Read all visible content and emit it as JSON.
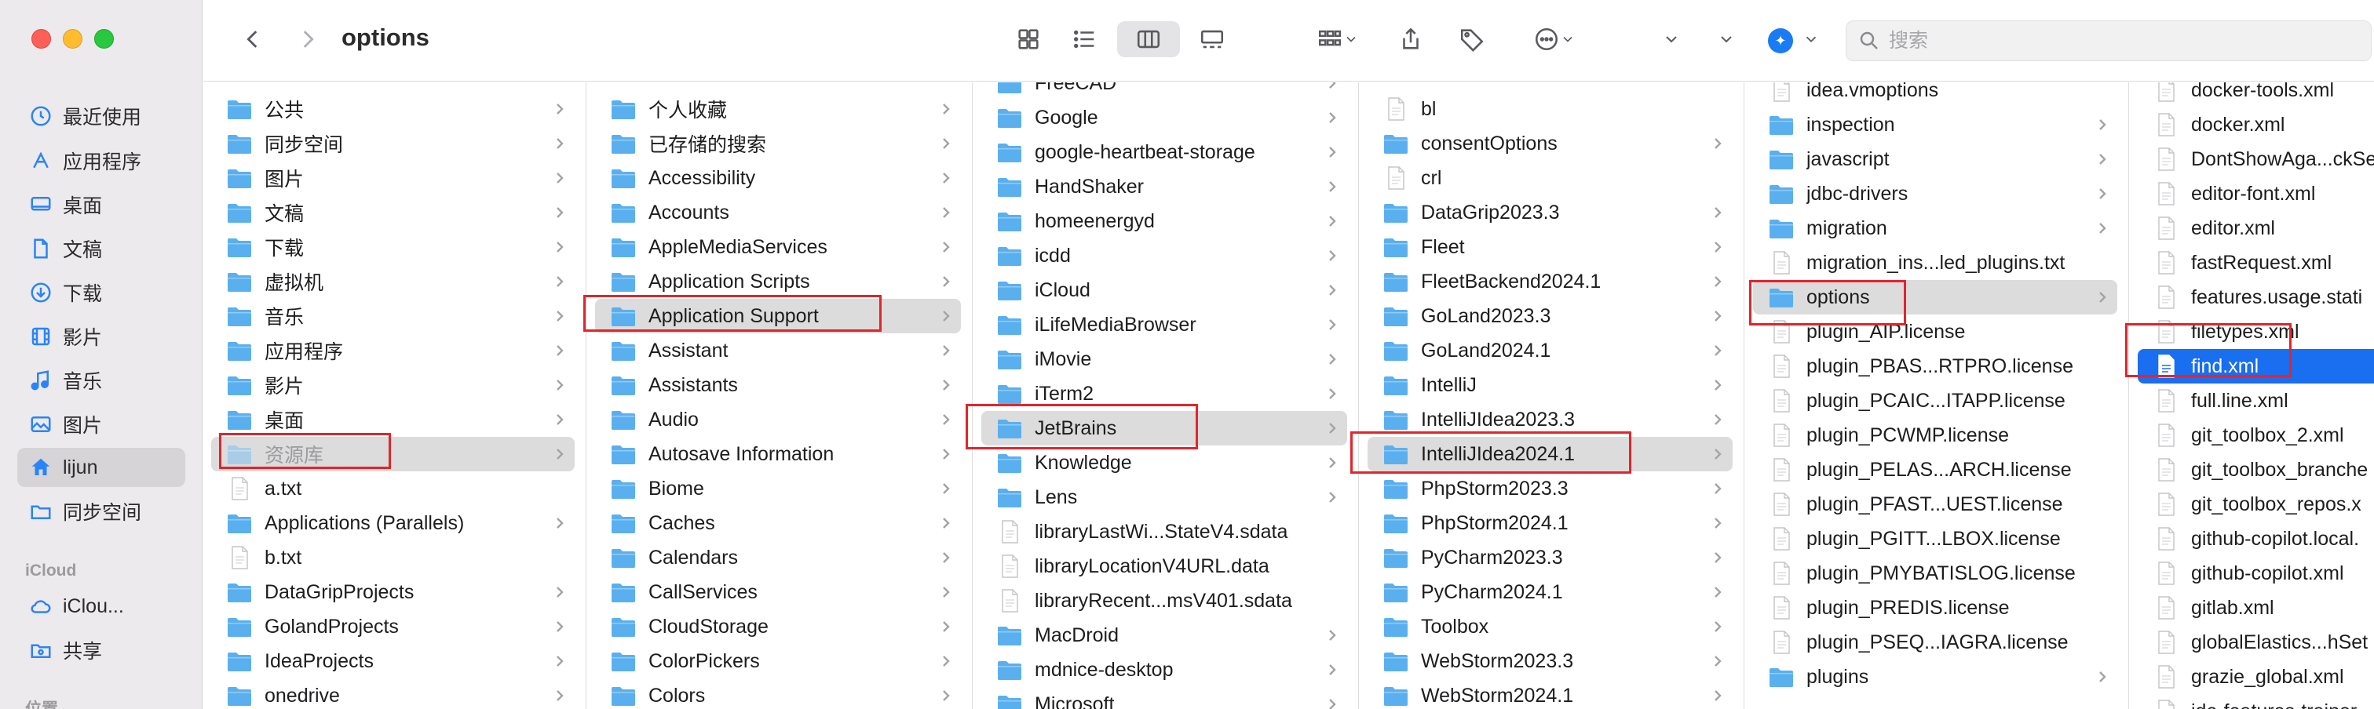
{
  "window": {
    "title": "options"
  },
  "search": {
    "placeholder": "搜索"
  },
  "colors": {
    "accent": "#1a6ef0",
    "folder": "#5ab0ef",
    "annotation": "#e4242b"
  },
  "sidebar": {
    "items": [
      {
        "label": "最近使用",
        "icon": "clock-icon"
      },
      {
        "label": "应用程序",
        "icon": "apps-icon"
      },
      {
        "label": "桌面",
        "icon": "desktop-icon"
      },
      {
        "label": "文稿",
        "icon": "doc-icon"
      },
      {
        "label": "下载",
        "icon": "download-icon"
      },
      {
        "label": "影片",
        "icon": "film-icon"
      },
      {
        "label": "音乐",
        "icon": "music-icon"
      },
      {
        "label": "图片",
        "icon": "photo-icon"
      },
      {
        "label": "lijun",
        "icon": "home-icon"
      },
      {
        "label": "同步空间",
        "icon": "folder-icon"
      }
    ],
    "section_icloud": "iCloud",
    "icloud_items": [
      {
        "label": "iClou...",
        "icon": "cloud-icon"
      },
      {
        "label": "共享",
        "icon": "shared-icon"
      }
    ],
    "section_locations": "位置"
  },
  "columns": [
    {
      "items": [
        {
          "name": "公共",
          "type": "folder",
          "chev": true
        },
        {
          "name": "同步空间",
          "type": "folder",
          "chev": true
        },
        {
          "name": "图片",
          "type": "folder",
          "chev": true
        },
        {
          "name": "文稿",
          "type": "folder",
          "chev": true
        },
        {
          "name": "下载",
          "type": "folder",
          "chev": true
        },
        {
          "name": "虚拟机",
          "type": "folder",
          "chev": true
        },
        {
          "name": "音乐",
          "type": "folder",
          "chev": true
        },
        {
          "name": "应用程序",
          "type": "folder",
          "chev": true
        },
        {
          "name": "影片",
          "type": "folder",
          "chev": true
        },
        {
          "name": "桌面",
          "type": "folder",
          "chev": true
        },
        {
          "name": "资源库",
          "type": "folder",
          "chev": true
        },
        {
          "name": "a.txt",
          "type": "file",
          "chev": false
        },
        {
          "name": "Applications (Parallels)",
          "type": "folder",
          "chev": true
        },
        {
          "name": "b.txt",
          "type": "file",
          "chev": false
        },
        {
          "name": "DataGripProjects",
          "type": "folder",
          "chev": true
        },
        {
          "name": "GolandProjects",
          "type": "folder",
          "chev": true
        },
        {
          "name": "IdeaProjects",
          "type": "folder",
          "chev": true
        },
        {
          "name": "onedrive",
          "type": "folder",
          "chev": true
        }
      ]
    },
    {
      "items": [
        {
          "name": "个人收藏",
          "type": "folder",
          "chev": true
        },
        {
          "name": "已存储的搜索",
          "type": "folder",
          "chev": true
        },
        {
          "name": "Accessibility",
          "type": "folder",
          "chev": true
        },
        {
          "name": "Accounts",
          "type": "folder",
          "chev": true
        },
        {
          "name": "AppleMediaServices",
          "type": "folder",
          "chev": true
        },
        {
          "name": "Application Scripts",
          "type": "folder",
          "chev": true
        },
        {
          "name": "Application Support",
          "type": "folder",
          "chev": true
        },
        {
          "name": "Assistant",
          "type": "folder",
          "chev": true
        },
        {
          "name": "Assistants",
          "type": "folder",
          "chev": true
        },
        {
          "name": "Audio",
          "type": "folder",
          "chev": true
        },
        {
          "name": "Autosave Information",
          "type": "folder",
          "chev": true
        },
        {
          "name": "Biome",
          "type": "folder",
          "chev": true
        },
        {
          "name": "Caches",
          "type": "folder",
          "chev": true
        },
        {
          "name": "Calendars",
          "type": "folder",
          "chev": true
        },
        {
          "name": "CallServices",
          "type": "folder",
          "chev": true
        },
        {
          "name": "CloudStorage",
          "type": "folder",
          "chev": true
        },
        {
          "name": "ColorPickers",
          "type": "folder",
          "chev": true
        },
        {
          "name": "Colors",
          "type": "folder",
          "chev": true
        }
      ]
    },
    {
      "items": [
        {
          "name": "FreeCAD",
          "type": "folder",
          "chev": true
        },
        {
          "name": "Google",
          "type": "folder",
          "chev": true
        },
        {
          "name": "google-heartbeat-storage",
          "type": "folder",
          "chev": true
        },
        {
          "name": "HandShaker",
          "type": "folder",
          "chev": true
        },
        {
          "name": "homeenergyd",
          "type": "folder",
          "chev": true
        },
        {
          "name": "icdd",
          "type": "folder",
          "chev": true
        },
        {
          "name": "iCloud",
          "type": "folder",
          "chev": true
        },
        {
          "name": "iLifeMediaBrowser",
          "type": "folder",
          "chev": true
        },
        {
          "name": "iMovie",
          "type": "folder",
          "chev": true
        },
        {
          "name": "iTerm2",
          "type": "folder",
          "chev": true
        },
        {
          "name": "JetBrains",
          "type": "folder",
          "chev": true
        },
        {
          "name": "Knowledge",
          "type": "folder",
          "chev": true
        },
        {
          "name": "Lens",
          "type": "folder",
          "chev": true
        },
        {
          "name": "libraryLastWi...StateV4.sdata",
          "type": "file",
          "chev": false
        },
        {
          "name": "libraryLocationV4URL.data",
          "type": "file",
          "chev": false
        },
        {
          "name": "libraryRecent...msV401.sdata",
          "type": "file",
          "chev": false
        },
        {
          "name": "MacDroid",
          "type": "folder",
          "chev": true
        },
        {
          "name": "mdnice-desktop",
          "type": "folder",
          "chev": true
        },
        {
          "name": "Microsoft",
          "type": "folder",
          "chev": true
        }
      ]
    },
    {
      "items": [
        {
          "name": "bl",
          "type": "file",
          "chev": false
        },
        {
          "name": "consentOptions",
          "type": "folder",
          "chev": true
        },
        {
          "name": "crl",
          "type": "file",
          "chev": false
        },
        {
          "name": "DataGrip2023.3",
          "type": "folder",
          "chev": true
        },
        {
          "name": "Fleet",
          "type": "folder",
          "chev": true
        },
        {
          "name": "FleetBackend2024.1",
          "type": "folder",
          "chev": true
        },
        {
          "name": "GoLand2023.3",
          "type": "folder",
          "chev": true
        },
        {
          "name": "GoLand2024.1",
          "type": "folder",
          "chev": true
        },
        {
          "name": "IntelliJ",
          "type": "folder",
          "chev": true
        },
        {
          "name": "IntelliJIdea2023.3",
          "type": "folder",
          "chev": true
        },
        {
          "name": "IntelliJIdea2024.1",
          "type": "folder",
          "chev": true
        },
        {
          "name": "PhpStorm2023.3",
          "type": "folder",
          "chev": true
        },
        {
          "name": "PhpStorm2024.1",
          "type": "folder",
          "chev": true
        },
        {
          "name": "PyCharm2023.3",
          "type": "folder",
          "chev": true
        },
        {
          "name": "PyCharm2024.1",
          "type": "folder",
          "chev": true
        },
        {
          "name": "Toolbox",
          "type": "folder",
          "chev": true
        },
        {
          "name": "WebStorm2023.3",
          "type": "folder",
          "chev": true
        },
        {
          "name": "WebStorm2024.1",
          "type": "folder",
          "chev": true
        }
      ]
    },
    {
      "items": [
        {
          "name": "idea.vmoptions",
          "type": "file",
          "chev": false
        },
        {
          "name": "inspection",
          "type": "folder",
          "chev": true
        },
        {
          "name": "javascript",
          "type": "folder",
          "chev": true
        },
        {
          "name": "jdbc-drivers",
          "type": "folder",
          "chev": true
        },
        {
          "name": "migration",
          "type": "folder",
          "chev": true
        },
        {
          "name": "migration_ins...led_plugins.txt",
          "type": "file",
          "chev": false
        },
        {
          "name": "options",
          "type": "folder",
          "chev": true
        },
        {
          "name": "plugin_AIP.license",
          "type": "file",
          "chev": false
        },
        {
          "name": "plugin_PBAS...RTPRO.license",
          "type": "file",
          "chev": false
        },
        {
          "name": "plugin_PCAIC...ITAPP.license",
          "type": "file",
          "chev": false
        },
        {
          "name": "plugin_PCWMP.license",
          "type": "file",
          "chev": false
        },
        {
          "name": "plugin_PELAS...ARCH.license",
          "type": "file",
          "chev": false
        },
        {
          "name": "plugin_PFAST...UEST.license",
          "type": "file",
          "chev": false
        },
        {
          "name": "plugin_PGITT...LBOX.license",
          "type": "file",
          "chev": false
        },
        {
          "name": "plugin_PMYBATISLOG.license",
          "type": "file",
          "chev": false
        },
        {
          "name": "plugin_PREDIS.license",
          "type": "file",
          "chev": false
        },
        {
          "name": "plugin_PSEQ...IAGRA.license",
          "type": "file",
          "chev": false
        },
        {
          "name": "plugins",
          "type": "folder",
          "chev": true
        }
      ]
    },
    {
      "items": [
        {
          "name": "docker-tools.xml",
          "type": "file",
          "chev": false
        },
        {
          "name": "docker.xml",
          "type": "file",
          "chev": false
        },
        {
          "name": "DontShowAga...ckSe",
          "type": "file",
          "chev": false
        },
        {
          "name": "editor-font.xml",
          "type": "file",
          "chev": false
        },
        {
          "name": "editor.xml",
          "type": "file",
          "chev": false
        },
        {
          "name": "fastRequest.xml",
          "type": "file",
          "chev": false
        },
        {
          "name": "features.usage.stati",
          "type": "file",
          "chev": false
        },
        {
          "name": "filetypes.xml",
          "type": "file",
          "chev": false
        },
        {
          "name": "find.xml",
          "type": "file",
          "chev": false
        },
        {
          "name": "full.line.xml",
          "type": "file",
          "chev": false
        },
        {
          "name": "git_toolbox_2.xml",
          "type": "file",
          "chev": false
        },
        {
          "name": "git_toolbox_branche",
          "type": "file",
          "chev": false
        },
        {
          "name": "git_toolbox_repos.x",
          "type": "file",
          "chev": false
        },
        {
          "name": "github-copilot.local.",
          "type": "file",
          "chev": false
        },
        {
          "name": "github-copilot.xml",
          "type": "file",
          "chev": false
        },
        {
          "name": "gitlab.xml",
          "type": "file",
          "chev": false
        },
        {
          "name": "globalElastics...hSet",
          "type": "file",
          "chev": false
        },
        {
          "name": "grazie_global.xml",
          "type": "file",
          "chev": false
        },
        {
          "name": "ide-features-trainer.",
          "type": "file",
          "chev": false
        }
      ]
    }
  ]
}
